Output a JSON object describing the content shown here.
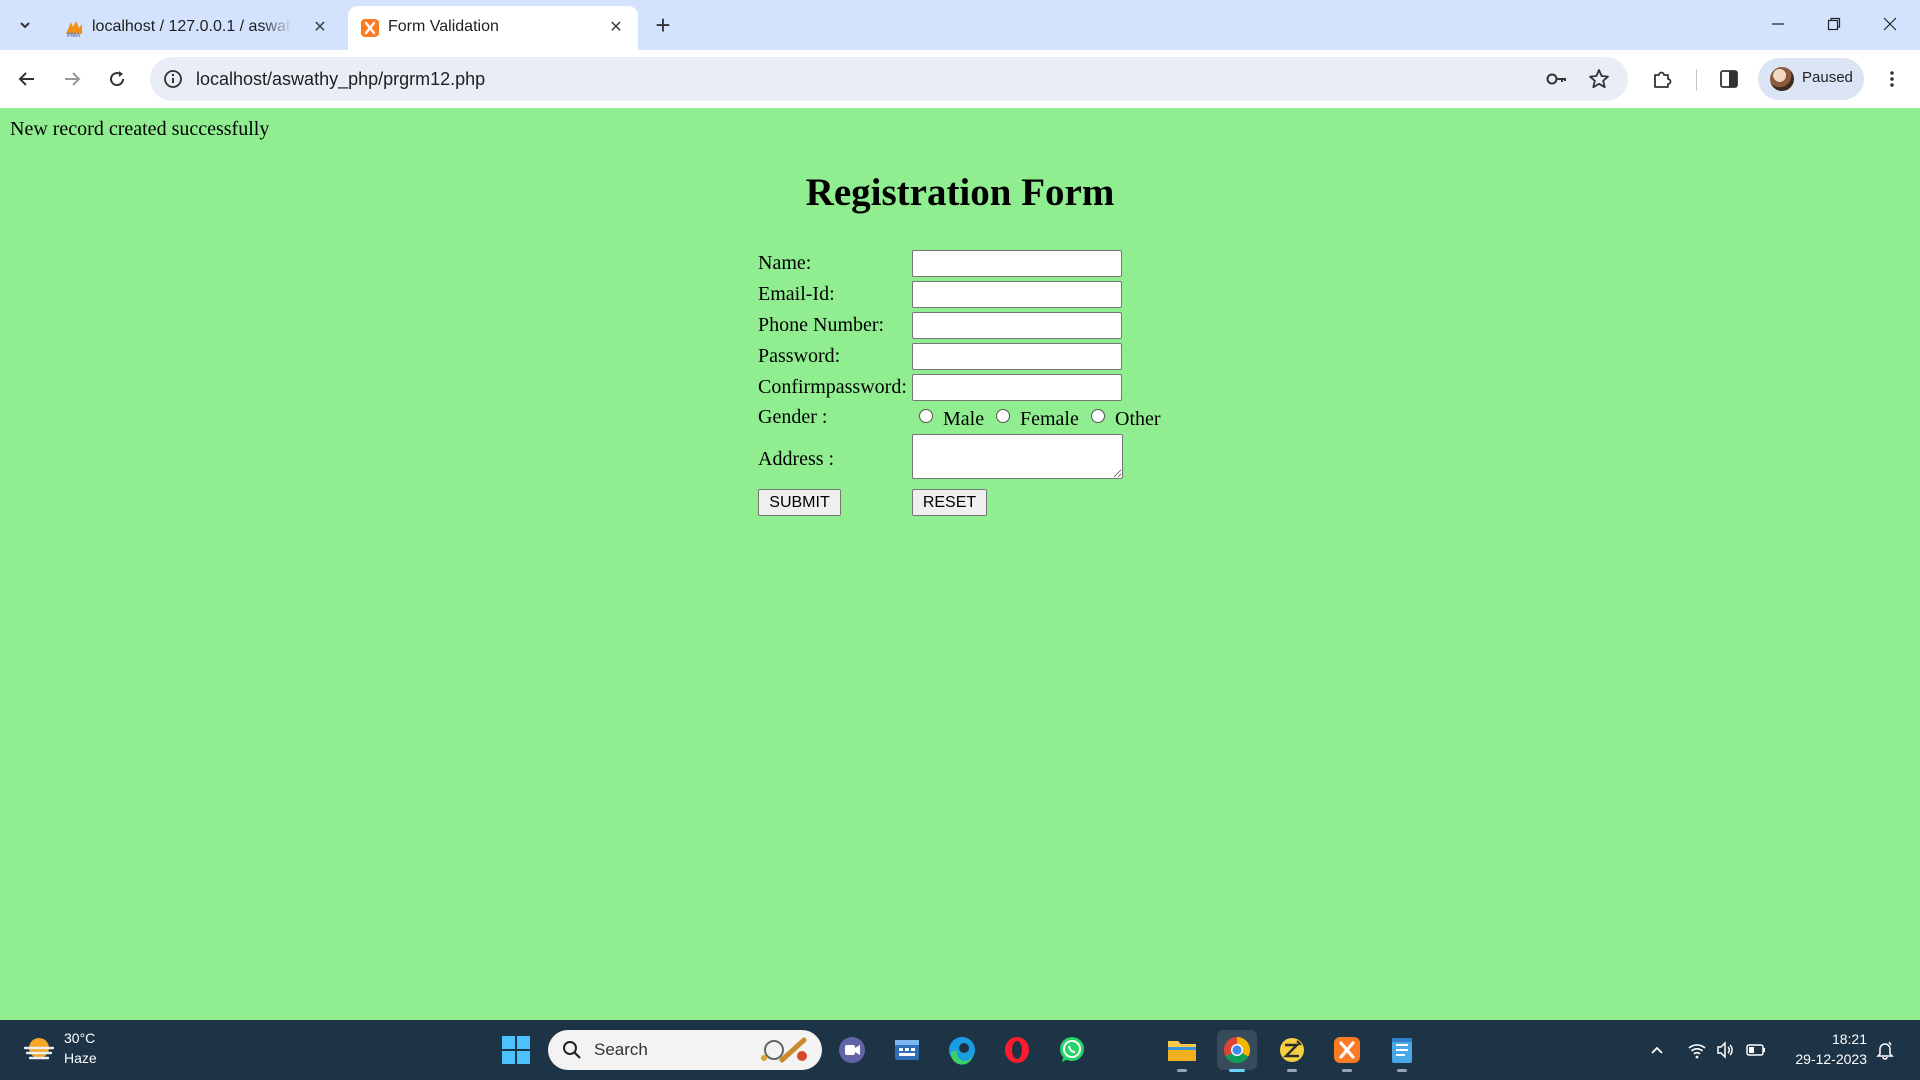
{
  "browser": {
    "tabs": [
      {
        "title": "localhost / 127.0.0.1 / aswathy_php",
        "favicon": "phpmyadmin-icon",
        "active": false
      },
      {
        "title": "Form Validation",
        "favicon": "xampp-icon",
        "active": true
      }
    ],
    "url": "localhost/aswathy_php/prgrm12.php",
    "profile_label": "Paused"
  },
  "page": {
    "status_message": "New record created successfully",
    "title": "Registration Form",
    "form": {
      "name_label": "Name:",
      "email_label": "Email-Id:",
      "phone_label": "Phone Number:",
      "password_label": "Password:",
      "confirm_label": "Confirmpassword:",
      "gender_label": "Gender :",
      "gender_options": [
        "Male",
        "Female",
        "Other"
      ],
      "address_label": "Address :",
      "submit_label": "SUBMIT",
      "reset_label": "RESET"
    },
    "background_color": "#90ee90"
  },
  "taskbar": {
    "weather_temp": "30°C",
    "weather_condition": "Haze",
    "search_placeholder": "Search",
    "time": "18:21",
    "date": "29-12-2023",
    "apps": [
      "windows-start-icon",
      "search",
      "meet-icon",
      "store-icon",
      "edge-icon",
      "opera-icon",
      "whatsapp-icon",
      "file-explorer-icon",
      "chrome-icon",
      "app-icon",
      "xampp-icon",
      "notepad-icon"
    ]
  }
}
